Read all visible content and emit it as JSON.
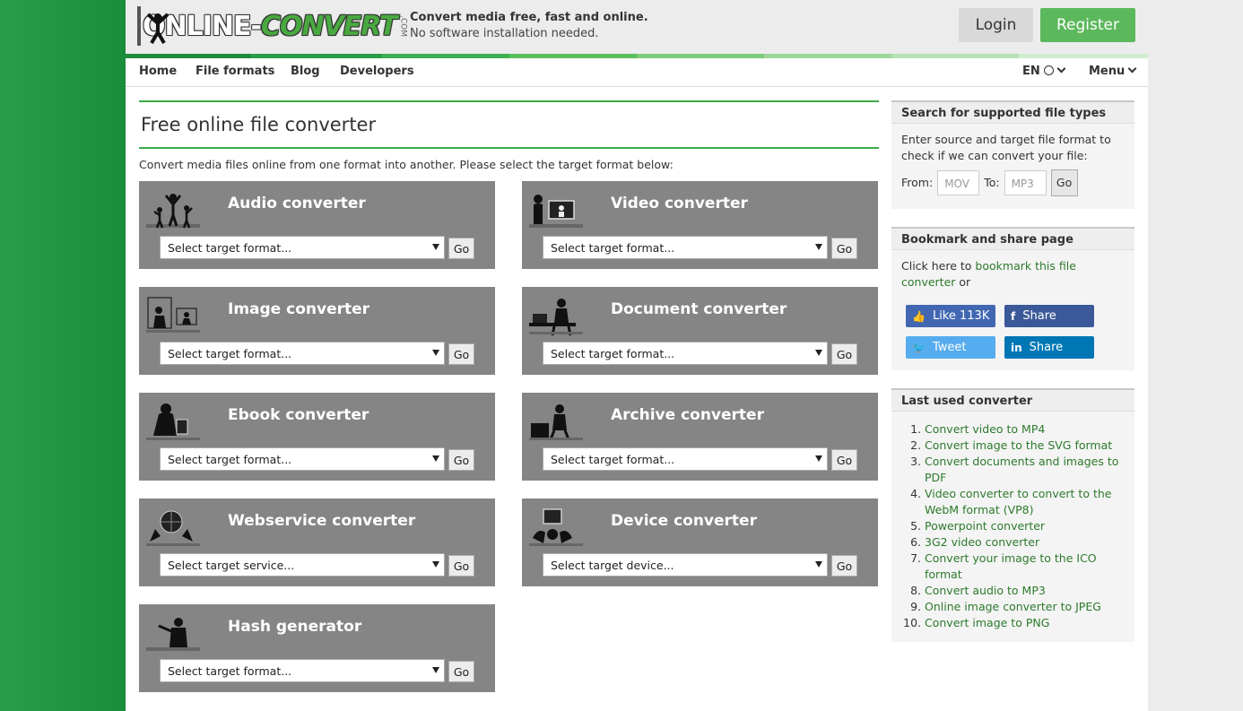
{
  "header": {
    "logo_text_1": "ONLINE-",
    "logo_text_2": "CONVERT",
    "logo_com": ".COM",
    "tagline_1": "Convert media free, fast and online.",
    "tagline_2": "No software installation needed.",
    "login_label": "Login",
    "register_label": "Register"
  },
  "nav": {
    "items": [
      "Home",
      "File formats",
      "Blog",
      "Developers"
    ],
    "language": "EN",
    "menu_label": "Menu"
  },
  "main": {
    "title": "Free online file converter",
    "intro": "Convert media files online from one format into another. Please select the target format below:",
    "go_label": "Go",
    "converters": [
      {
        "title": "Audio converter",
        "select": "Select target format..."
      },
      {
        "title": "Video converter",
        "select": "Select target format..."
      },
      {
        "title": "Image converter",
        "select": "Select target format..."
      },
      {
        "title": "Document converter",
        "select": "Select target format..."
      },
      {
        "title": "Ebook converter",
        "select": "Select target format..."
      },
      {
        "title": "Archive converter",
        "select": "Select target format..."
      },
      {
        "title": "Webservice converter",
        "select": "Select target service..."
      },
      {
        "title": "Device converter",
        "select": "Select target device..."
      },
      {
        "title": "Hash generator",
        "select": "Select target format..."
      }
    ]
  },
  "sidebar": {
    "search": {
      "title": "Search for supported file types",
      "desc": "Enter source and target file format to check if we can convert your file:",
      "from_label": "From:",
      "from_placeholder": "MOV",
      "to_label": "To:",
      "to_placeholder": "MP3",
      "go_label": "Go"
    },
    "bookmark": {
      "title": "Bookmark and share page",
      "text_prefix": "Click here to ",
      "link": "bookmark this file converter",
      "text_suffix": " or",
      "like_label": "Like 113K",
      "fb_share_label": "Share",
      "tweet_label": "Tweet",
      "in_share_label": "Share"
    },
    "last_used": {
      "title": "Last used converter",
      "items": [
        "Convert video to MP4",
        "Convert image to the SVG format",
        "Convert documents and images to PDF",
        "Video converter to convert to the WebM format (VP8)",
        "Powerpoint converter",
        "3G2 video converter",
        "Convert your image to the ICO format",
        "Convert audio to MP3",
        "Online image converter to JPEG",
        "Convert image to PNG"
      ]
    }
  },
  "colors": {
    "brand_green": "#5cb85c",
    "link_green": "#2d7a2d",
    "panel_gray": "#858585",
    "facebook": "#3b5998",
    "twitter": "#55acee",
    "linkedin": "#0077b5"
  }
}
